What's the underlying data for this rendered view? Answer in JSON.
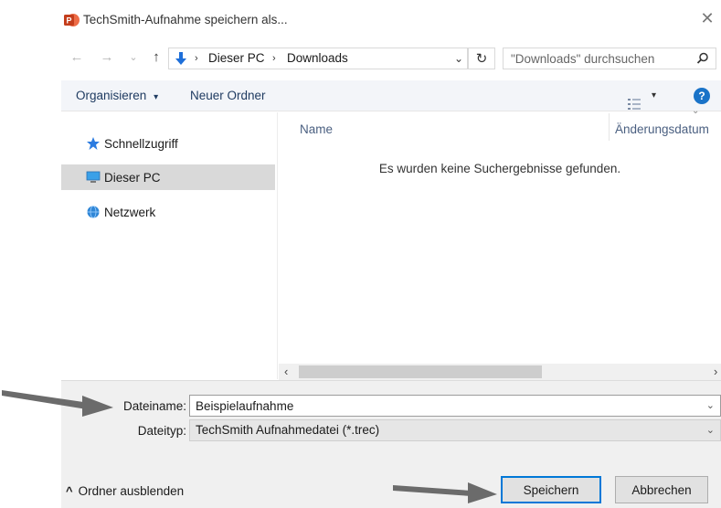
{
  "window": {
    "title": "TechSmith-Aufnahme speichern als...",
    "close_glyph": "✕",
    "app_icon": "powerpoint-app-icon"
  },
  "navigation": {
    "back_glyph": "←",
    "forward_glyph": "→",
    "recent_glyph": "⌄",
    "up_glyph": "↑",
    "breadcrumb": [
      "Dieser PC",
      "Downloads"
    ],
    "breadcrumb_sep": "›",
    "address_dropdown_glyph": "⌄",
    "refresh_glyph": "↻",
    "search_placeholder": "\"Downloads\" durchsuchen",
    "search_icon": "search-icon"
  },
  "toolbar": {
    "organize_label": "Organisieren",
    "organize_caret": "▾",
    "new_folder_label": "Neuer Ordner",
    "view_caret": "▾",
    "help_glyph": "?"
  },
  "sidebar": {
    "items": [
      {
        "label": "Schnellzugriff",
        "icon": "star-icon",
        "selected": false
      },
      {
        "label": "Dieser PC",
        "icon": "computer-icon",
        "selected": true
      },
      {
        "label": "Netzwerk",
        "icon": "network-icon",
        "selected": false
      }
    ]
  },
  "file_list": {
    "columns": [
      "Name",
      "Änderungsdatum"
    ],
    "sort_glyph": "⌄",
    "empty_message": "Es wurden keine Suchergebnisse gefunden.",
    "scroll_left_glyph": "‹",
    "scroll_right_glyph": "›"
  },
  "form": {
    "filename_label": "Dateiname:",
    "filename_value": "Beispielaufnahme",
    "filetype_label": "Dateityp:",
    "filetype_value": "TechSmith Aufnahmedatei (*.trec)",
    "dropdown_glyph": "⌄"
  },
  "footer": {
    "hide_folders_glyph": "^",
    "hide_folders_label": "Ordner ausblenden",
    "save_label": "Speichern",
    "cancel_label": "Abbrechen"
  },
  "colors": {
    "accent": "#0078d7",
    "help_icon": "#1a73c8",
    "annotation_arrow": "#6b6b6b"
  }
}
